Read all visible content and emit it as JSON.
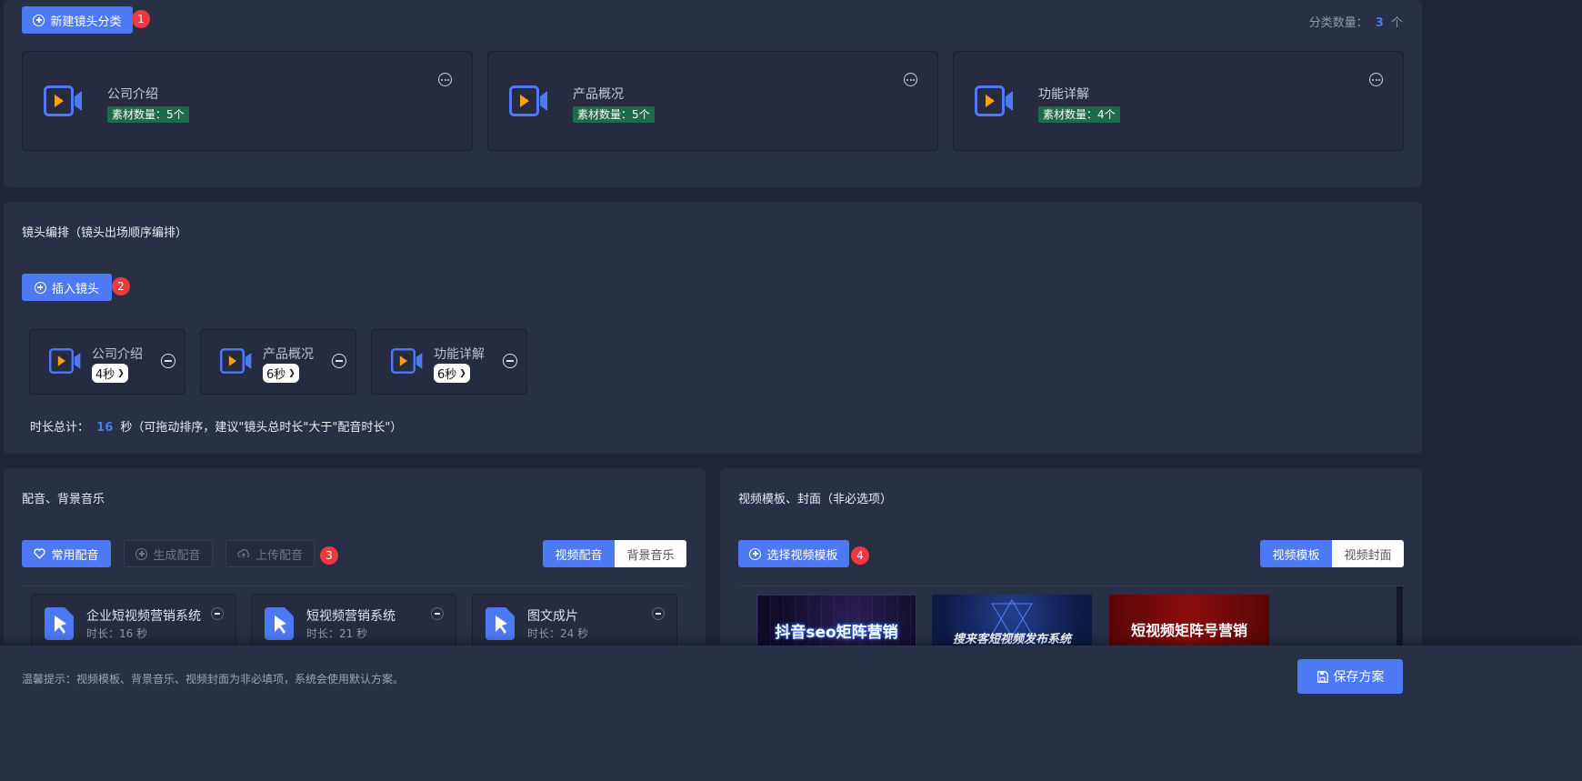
{
  "categories": {
    "new_button": "新建镜头分类",
    "new_badge": "1",
    "count_label": "分类数量：",
    "count_value": "3",
    "count_unit": "个",
    "items": [
      {
        "name": "公司介绍",
        "materials": "素材数量：5个"
      },
      {
        "name": "产品概况",
        "materials": "素材数量：5个"
      },
      {
        "name": "功能详解",
        "materials": "素材数量：4个"
      }
    ]
  },
  "shots": {
    "title": "镜头编排（镜头出场顺序编排）",
    "insert_button": "插入镜头",
    "insert_badge": "2",
    "items": [
      {
        "name": "公司介绍",
        "duration": "4秒"
      },
      {
        "name": "产品概况",
        "duration": "6秒"
      },
      {
        "name": "功能详解",
        "duration": "6秒"
      }
    ],
    "total_label": "时长总计：",
    "total_value": "16",
    "total_suffix": "秒（可拖动排序，建议\"镜头总时长\"大于\"配音时长\"）"
  },
  "audio": {
    "title": "配音、背景音乐",
    "common_button": "常用配音",
    "generate_button": "生成配音",
    "upload_button": "上传配音",
    "badge": "3",
    "tabs": [
      "视频配音",
      "背景音乐"
    ],
    "items": [
      {
        "name": "企业短视频营销系统",
        "duration": "时长：16 秒"
      },
      {
        "name": "短视频营销系统",
        "duration": "时长：21 秒"
      },
      {
        "name": "图文成片",
        "duration": "时长：24 秒"
      }
    ]
  },
  "template": {
    "title": "视频模板、封面（非必选项）",
    "select_button": "选择视频模板",
    "badge": "4",
    "tabs": [
      "视频模板",
      "视频封面"
    ],
    "thumbs": [
      "抖音seo矩阵营销",
      "搜来客短视频发布系统",
      "短视频矩阵号营销"
    ]
  },
  "footer": {
    "tip": "温馨提示：视频模板、背景音乐、视频封面为非必填项，系统会使用默认方案。",
    "save_button": "保存方案"
  },
  "colors": {
    "accent": "#4e79f5",
    "badge": "#f0393e",
    "material": "#1e6b49",
    "cam_orange": "#f5a11c"
  }
}
